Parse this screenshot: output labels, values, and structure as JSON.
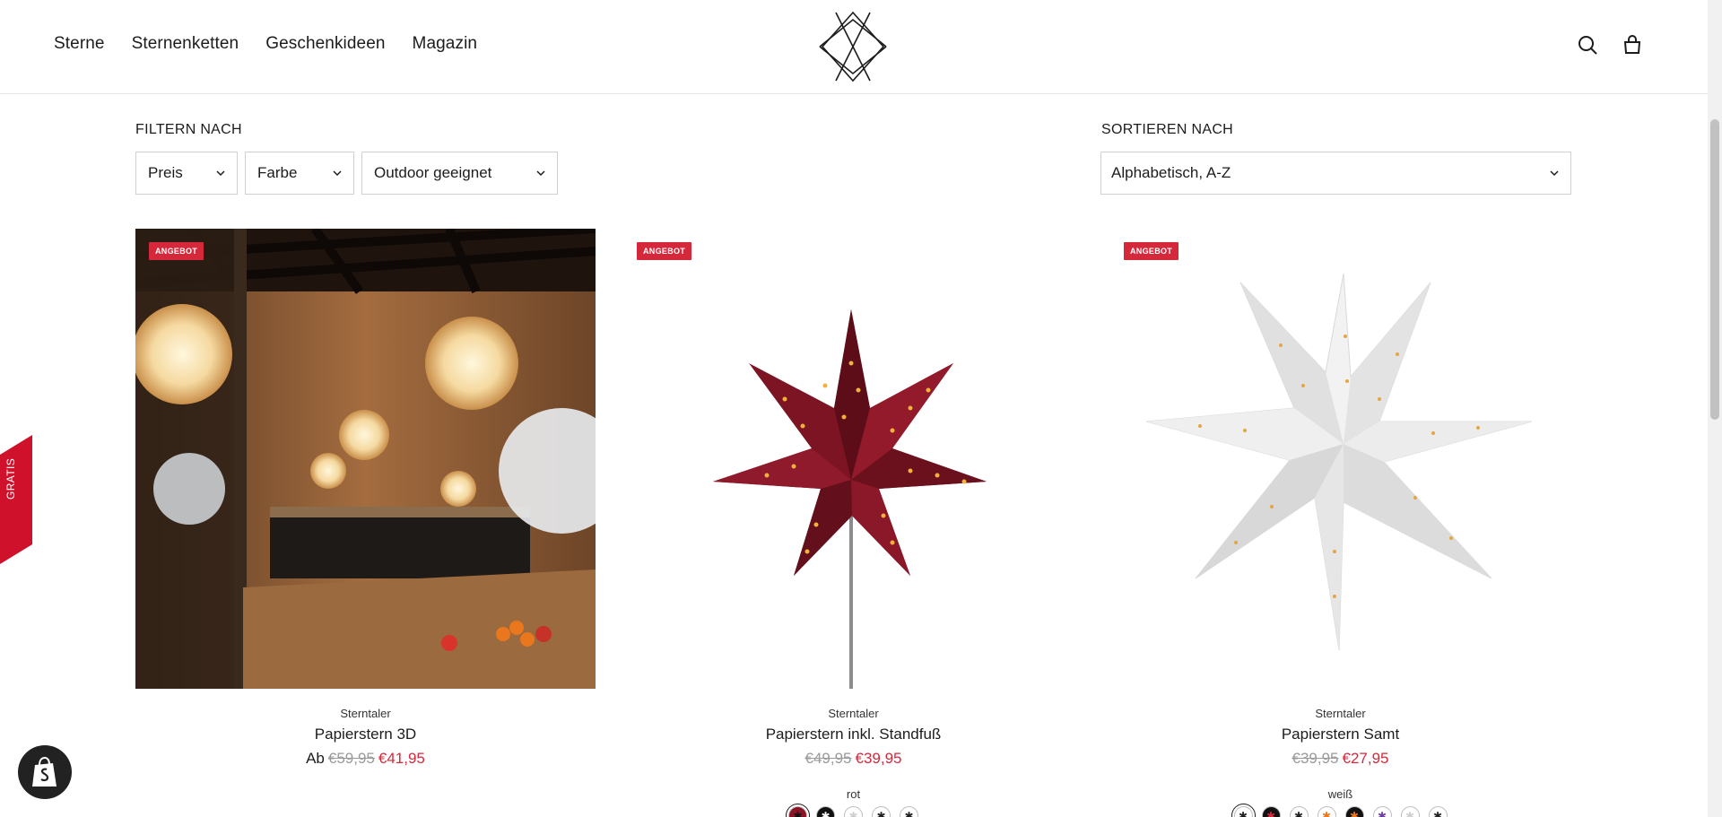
{
  "nav": {
    "items": [
      {
        "label": "Sterne"
      },
      {
        "label": "Sternenketten"
      },
      {
        "label": "Geschenkideen"
      },
      {
        "label": "Magazin"
      }
    ]
  },
  "header": {
    "logo_icon": "star-diamond-logo",
    "icons": [
      "search-icon",
      "cart-icon"
    ]
  },
  "filters": {
    "label": "FILTERN NACH",
    "items": [
      {
        "label": "Preis"
      },
      {
        "label": "Farbe"
      },
      {
        "label": "Outdoor geeignet"
      }
    ]
  },
  "sort": {
    "label": "SORTIEREN NACH",
    "value": "Alphabetisch, A-Z"
  },
  "side_tab": {
    "label": "GRATIS",
    "color": "#d0112b"
  },
  "colors": {
    "sale": "#d6283b",
    "old_price": "#9a9a9a"
  },
  "products": [
    {
      "badge": "ANGEBOT",
      "vendor": "Sterntaler",
      "title": "Papierstern 3D",
      "price_prefix": "Ab",
      "old_price": "€59,95",
      "new_price": "€41,95",
      "image": "interior-room-with-paper-stars"
    },
    {
      "badge": "ANGEBOT",
      "vendor": "Sterntaler",
      "title": "Papierstern inkl. Standfuß",
      "old_price": "€49,95",
      "new_price": "€39,95",
      "swatch_label": "rot",
      "image": "red-paper-star-on-stand"
    },
    {
      "badge": "ANGEBOT",
      "vendor": "Sterntaler",
      "title": "Papierstern Samt",
      "old_price": "€39,95",
      "new_price": "€27,95",
      "swatch_label": "weiß",
      "image": "white-paper-star"
    }
  ]
}
